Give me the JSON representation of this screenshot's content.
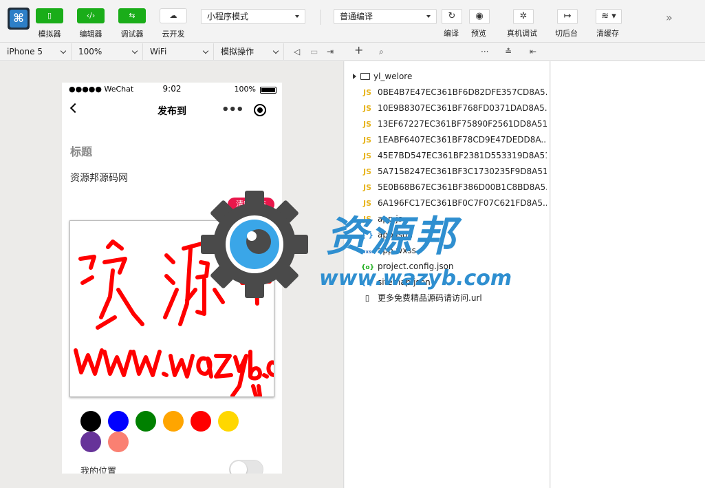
{
  "toolbar": {
    "simulator_label": "模拟器",
    "editor_label": "编辑器",
    "debugger_label": "调试器",
    "cloud_label": "云开发",
    "mode_select": "小程序模式",
    "compile_select": "普通编译",
    "compile_label": "编译",
    "preview_label": "预览",
    "remote_debug_label": "真机调试",
    "background_label": "切后台",
    "clear_cache_label": "清缓存",
    "simulator_icon": "phone-icon",
    "editor_icon": "code-icon",
    "debugger_icon": "sliders-icon",
    "cloud_icon": "cloud-icon"
  },
  "subbar": {
    "device": "iPhone 5",
    "zoom": "100%",
    "network": "WiFi",
    "operation": "模拟操作"
  },
  "phone": {
    "status": {
      "carrier": "●●●●● WeChat",
      "time": "9:02",
      "battery": "100%"
    },
    "nav_title": "发布到",
    "field_title": "标题",
    "field_value": "资源邦源码网",
    "clear_button": "清空画布",
    "location_label": "我的位置",
    "location_enabled": false,
    "palette": [
      "#000000",
      "#0000ff",
      "#008000",
      "#ffa500",
      "#ff0000",
      "#ffd700",
      "#663399",
      "#fa8072"
    ],
    "stroke_color": "#ff0000"
  },
  "filetree": {
    "folder": "yl_welore",
    "files": [
      {
        "type": "js",
        "icon": "JS",
        "name": "0BE4B7E47EC361BF6D82DFE357CD8A5..."
      },
      {
        "type": "js",
        "icon": "JS",
        "name": "10E9B8307EC361BF768FD0371DAD8A5..."
      },
      {
        "type": "js",
        "icon": "JS",
        "name": "13EF67227EC361BF75890F2561DD8A51.js"
      },
      {
        "type": "js",
        "icon": "JS",
        "name": "1EABF6407EC361BF78CD9E47DEDD8A..."
      },
      {
        "type": "js",
        "icon": "JS",
        "name": "45E7BD547EC361BF2381D553319D8A51.js"
      },
      {
        "type": "js",
        "icon": "JS",
        "name": "5A7158247EC361BF3C1730235F9D8A51.js"
      },
      {
        "type": "js",
        "icon": "JS",
        "name": "5E0B68B67EC361BF386D00B1C8BD8A5..."
      },
      {
        "type": "js",
        "icon": "JS",
        "name": "6A196FC17EC361BF0C7F07C621FD8A5..."
      },
      {
        "type": "js",
        "icon": "JS",
        "name": "app.js"
      },
      {
        "type": "json",
        "icon": "{ }",
        "name": "app.json"
      },
      {
        "type": "wxss",
        "icon": "wxss",
        "name": "app.wxss"
      },
      {
        "type": "cfg",
        "icon": "{o}",
        "name": "project.config.json"
      },
      {
        "type": "json",
        "icon": "{ }",
        "name": "sitemap.json"
      },
      {
        "type": "doc",
        "icon": "▯",
        "name": "更多免费精品源码请访问.url"
      }
    ]
  },
  "watermark": {
    "text": "资源邦",
    "url": "www.wazyb.com"
  },
  "colors": {
    "accent_green": "#1aad19",
    "clear_red": "#e8174b",
    "watermark_blue": "#2f8fd0"
  }
}
